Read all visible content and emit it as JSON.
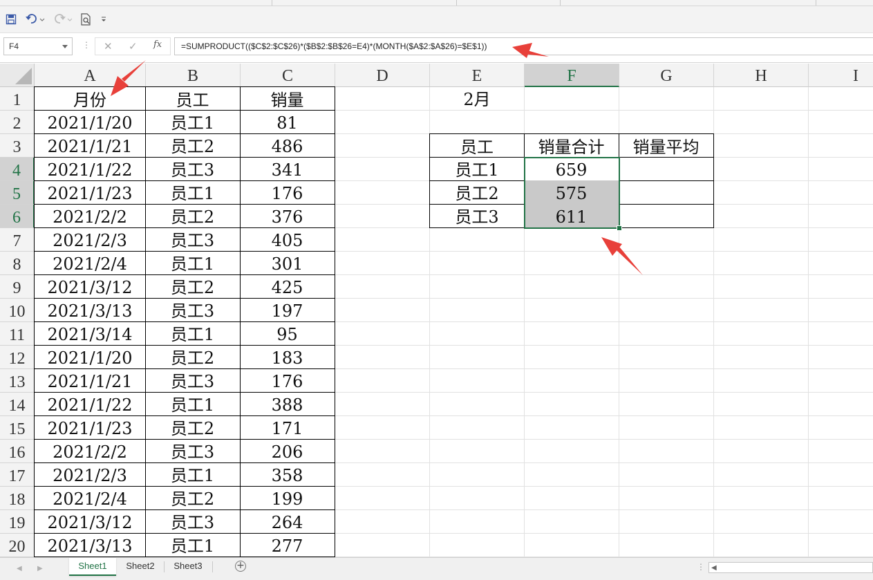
{
  "name_box": {
    "value": "F4"
  },
  "formula_bar": {
    "fx_label": "fx",
    "formula": "=SUMPRODUCT(($C$2:$C$26)*($B$2:$B$26=E4)*(MONTH($A$2:$A$26)=$E$1))"
  },
  "columns": [
    "A",
    "B",
    "C",
    "D",
    "E",
    "F",
    "G",
    "H",
    "I"
  ],
  "rows": [
    "1",
    "2",
    "3",
    "4",
    "5",
    "6",
    "7",
    "8",
    "9",
    "10",
    "11",
    "12",
    "13",
    "14",
    "15",
    "16",
    "17",
    "18",
    "19",
    "20"
  ],
  "sheet_main": {
    "headers": [
      "月份",
      "员工",
      "销量"
    ],
    "records": [
      [
        "2021/1/20",
        "员工1",
        "81"
      ],
      [
        "2021/1/21",
        "员工2",
        "486"
      ],
      [
        "2021/1/22",
        "员工3",
        "341"
      ],
      [
        "2021/1/23",
        "员工1",
        "176"
      ],
      [
        "2021/2/2",
        "员工2",
        "376"
      ],
      [
        "2021/2/3",
        "员工3",
        "405"
      ],
      [
        "2021/2/4",
        "员工1",
        "301"
      ],
      [
        "2021/3/12",
        "员工2",
        "425"
      ],
      [
        "2021/3/13",
        "员工3",
        "197"
      ],
      [
        "2021/3/14",
        "员工1",
        "95"
      ],
      [
        "2021/1/20",
        "员工2",
        "183"
      ],
      [
        "2021/1/21",
        "员工3",
        "176"
      ],
      [
        "2021/1/22",
        "员工1",
        "388"
      ],
      [
        "2021/1/23",
        "员工2",
        "171"
      ],
      [
        "2021/2/2",
        "员工3",
        "206"
      ],
      [
        "2021/2/3",
        "员工1",
        "358"
      ],
      [
        "2021/2/4",
        "员工2",
        "199"
      ],
      [
        "2021/3/12",
        "员工3",
        "264"
      ],
      [
        "2021/3/13",
        "员工1",
        "277"
      ]
    ]
  },
  "summary": {
    "month_label": "2月",
    "headers": [
      "员工",
      "销量合计",
      "销量平均"
    ],
    "rows": [
      [
        "员工1",
        "659",
        ""
      ],
      [
        "员工2",
        "575",
        ""
      ],
      [
        "员工3",
        "611",
        ""
      ]
    ]
  },
  "sheet_tabs": [
    "Sheet1",
    "Sheet2",
    "Sheet3"
  ],
  "colors": {
    "accent": "#217346",
    "selection_fill": "#c9c9c9",
    "arrow": "#e8403a"
  }
}
